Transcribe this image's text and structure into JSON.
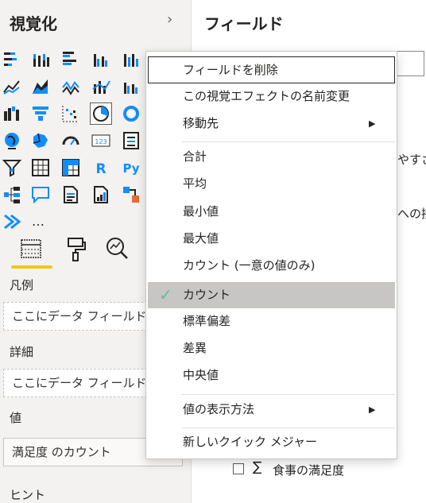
{
  "visualizations": {
    "title": "視覚化",
    "collapse_icon": "chevron-right-icon",
    "more_icon_text": "…",
    "icons": [
      "stacked-bar-icon",
      "stacked-column-icon",
      "clustered-bar-icon",
      "clustered-column-icon",
      "percent-bar-icon",
      "line-chart-icon",
      "area-chart-icon",
      "stacked-area-icon",
      "line-column-icon",
      "line-clustered-column-icon",
      "ribbon-icon",
      "waterfall-icon",
      "funnel-icon",
      "scatter-icon",
      "pie-icon",
      "donut-icon",
      "map-icon",
      "filled-map-icon",
      "gauge-icon",
      "card-icon",
      "multirow-card-icon",
      "slicer-icon",
      "table-icon",
      "matrix-icon",
      "r-visual-icon",
      "python-visual-icon",
      "decomposition-tree-icon",
      "qa-icon",
      "smart-narrative-icon",
      "paginated-report-icon",
      "power-automate-icon",
      "power-apps-icon",
      "more-visuals-icon"
    ],
    "selected_icon": "pie-icon",
    "tabs": [
      "fields-tab-icon",
      "format-tab-icon",
      "analytics-tab-icon"
    ],
    "wells": {
      "legend_label": "凡例",
      "legend_placeholder": "ここにデータ フィールドを追加します",
      "details_label": "詳細",
      "details_placeholder": "ここにデータ フィールドを追加します",
      "values_label": "値",
      "values_value": "満足度 のカウント",
      "tooltips_label": "ヒント"
    }
  },
  "fields": {
    "title": "フィールド",
    "partial_text_1": "やすさ",
    "partial_text_2": "への接",
    "field_item": "食事の満足度",
    "sigma": "∑"
  },
  "context_menu": {
    "items": [
      {
        "label": "フィールドを削除",
        "focused": true
      },
      {
        "label": "この視覚エフェクトの名前変更"
      },
      {
        "label": "移動先",
        "submenu": true
      },
      {
        "label": "合計"
      },
      {
        "label": "平均"
      },
      {
        "label": "最小値"
      },
      {
        "label": "最大値"
      },
      {
        "label": "カウント (一意の値のみ)"
      },
      {
        "label": "カウント",
        "checked": true
      },
      {
        "label": "標準偏差"
      },
      {
        "label": "差異"
      },
      {
        "label": "中央値"
      },
      {
        "label": "値の表示方法",
        "submenu": true
      },
      {
        "label": "新しいクイック メジャー"
      }
    ],
    "submenu_arrow": "▶",
    "checkmark": "✓"
  },
  "colors": {
    "accent": "#f2c811",
    "check": "#6bb69c",
    "icon_blue": "#118dff",
    "icon_dark": "#252423"
  }
}
